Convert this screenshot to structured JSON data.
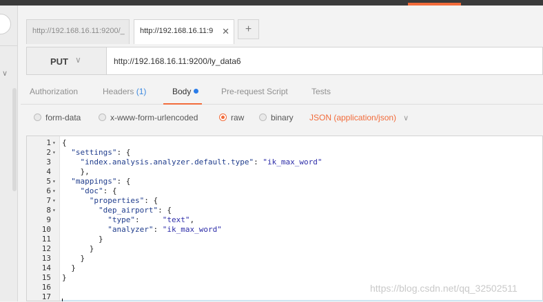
{
  "tabs": [
    {
      "label": "http://192.168.16.11:9200/_"
    },
    {
      "label": "http://192.168.16.11:9"
    }
  ],
  "tab_close_icon": "close-icon",
  "tab_add_icon": "plus-icon",
  "request": {
    "method": "PUT",
    "url": "http://192.168.16.11:9200/ly_data6"
  },
  "subtabs": {
    "authorization": "Authorization",
    "headers": "Headers",
    "headers_count": "(1)",
    "body": "Body",
    "prerequest": "Pre-request Script",
    "tests": "Tests"
  },
  "body_options": {
    "form_data": "form-data",
    "urlencoded": "x-www-form-urlencoded",
    "raw": "raw",
    "binary": "binary",
    "selected": "raw",
    "content_type": "JSON (application/json)"
  },
  "colors": {
    "accent": "#f26b3a",
    "dot": "#2b7de9"
  },
  "editor": {
    "line_numbers": [
      "1",
      "2",
      "3",
      "4",
      "5",
      "6",
      "7",
      "8",
      "9",
      "10",
      "11",
      "12",
      "13",
      "14",
      "15",
      "16",
      "17"
    ],
    "lines": [
      "{",
      "  \"settings\": {",
      "    \"index.analysis.analyzer.default.type\": \"ik_max_word\"",
      "    },",
      "  \"mappings\": {",
      "    \"doc\": {",
      "      \"properties\": {",
      "        \"dep_airport\": {",
      "          \"type\":     \"text\",",
      "          \"analyzer\": \"ik_max_word\"",
      "        }",
      "      }",
      "    }",
      "  }",
      "}",
      "",
      ""
    ]
  },
  "watermark": "https://blog.csdn.net/qq_32502511"
}
